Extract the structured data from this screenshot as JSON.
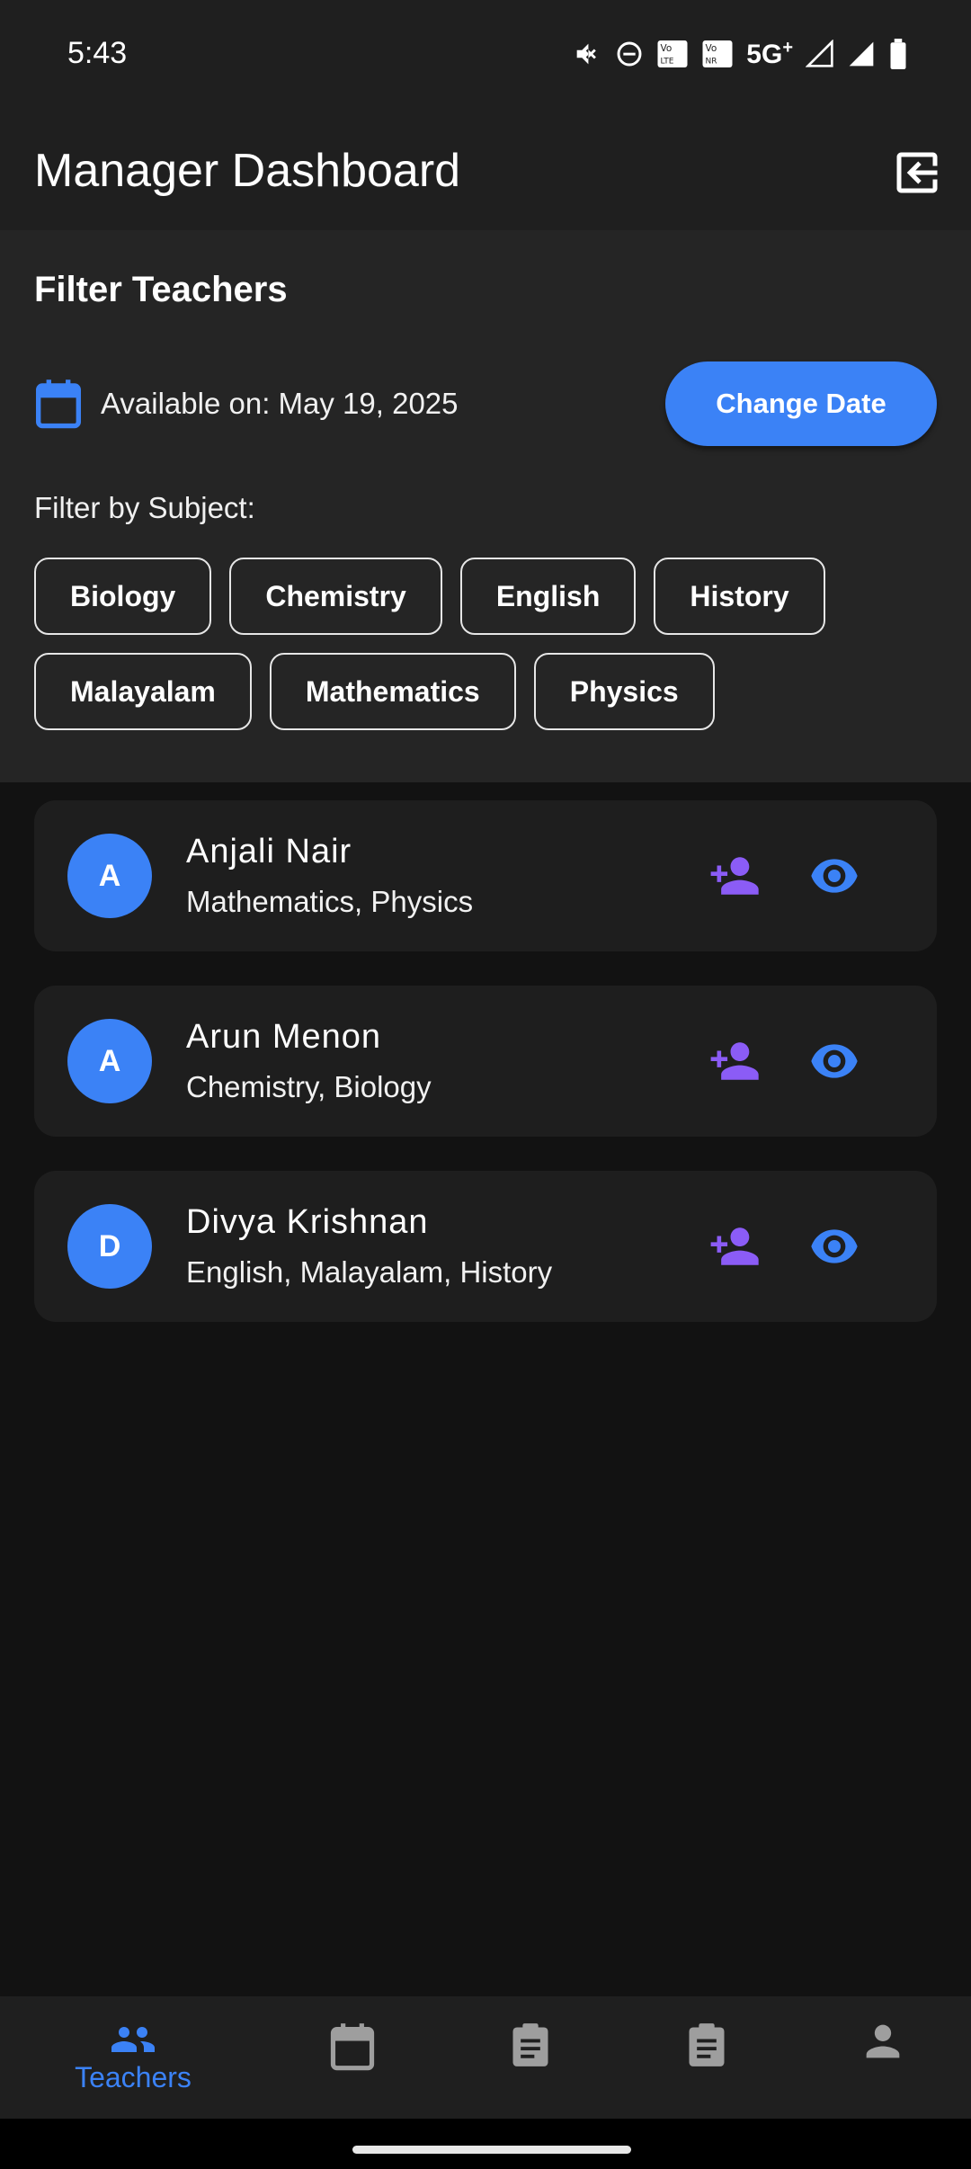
{
  "status_bar": {
    "time": "5:43",
    "network": "5G",
    "network_sup": "+"
  },
  "app_bar": {
    "title": "Manager Dashboard"
  },
  "filter": {
    "title": "Filter Teachers",
    "available_text": "Available on: May 19, 2025",
    "change_date_label": "Change Date",
    "subject_label": "Filter by Subject:",
    "subjects": [
      "Biology",
      "Chemistry",
      "English",
      "History",
      "Malayalam",
      "Mathematics",
      "Physics"
    ]
  },
  "teachers": [
    {
      "initial": "A",
      "name": "Anjali Nair",
      "subjects": "Mathematics, Physics"
    },
    {
      "initial": "A",
      "name": "Arun Menon",
      "subjects": "Chemistry, Biology"
    },
    {
      "initial": "D",
      "name": "Divya Krishnan",
      "subjects": "English, Malayalam, History"
    }
  ],
  "bottom_nav": {
    "items": [
      {
        "icon": "group-icon",
        "label": "Teachers",
        "active": true
      },
      {
        "icon": "calendar-icon",
        "label": "",
        "active": false
      },
      {
        "icon": "clipboard-icon",
        "label": "",
        "active": false
      },
      {
        "icon": "assignment-icon",
        "label": "",
        "active": false
      },
      {
        "icon": "person-icon",
        "label": "",
        "active": false
      }
    ]
  },
  "colors": {
    "accent": "#3b82f6",
    "purple": "#8b5cf6",
    "background": "#121212",
    "surface": "#1f1f1f",
    "panel": "#252525",
    "card": "#1e1e1e",
    "inactive_icon": "#9e9e9e"
  }
}
